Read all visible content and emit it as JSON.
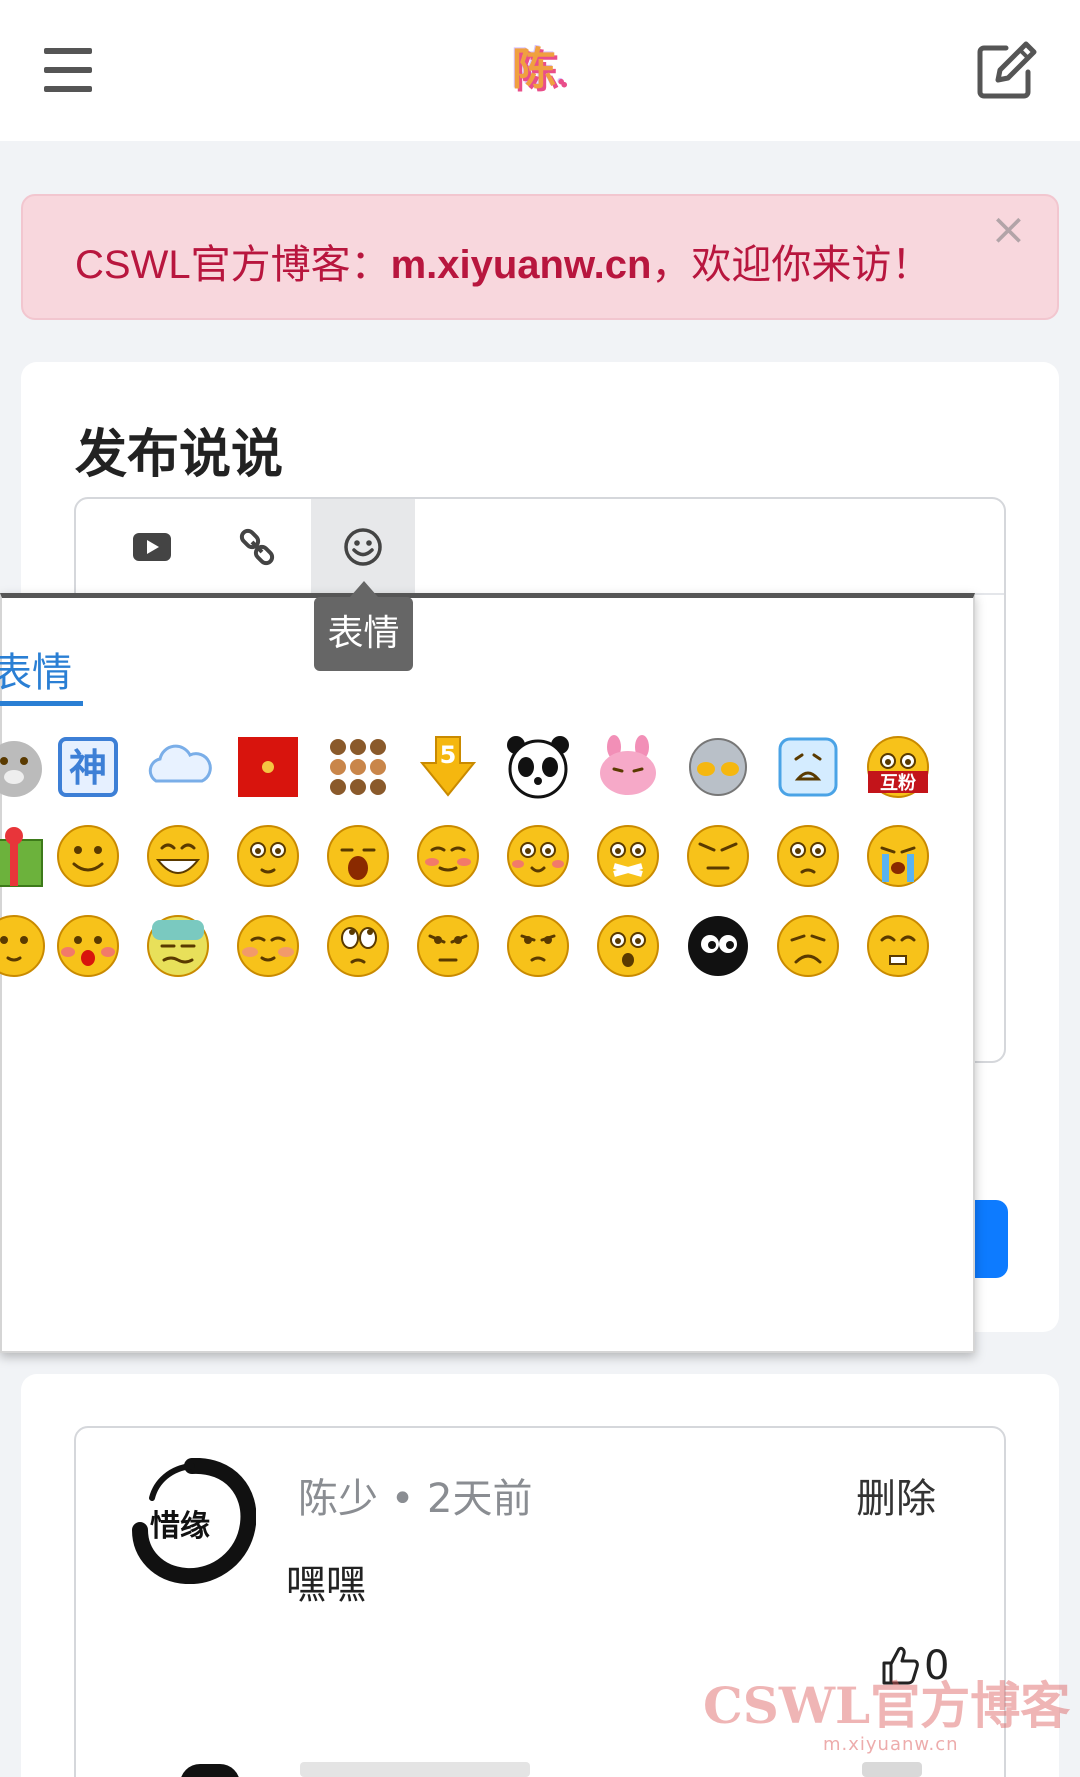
{
  "header": {
    "menu_icon": "hamburger-icon",
    "logo_text": "陈",
    "logo_dot": ".",
    "edit_icon": "edit-icon"
  },
  "alert": {
    "prefix": "CSWL官方博客：",
    "url": "m.xiyuanw.cn",
    "suffix": "，欢迎你来访！",
    "close": "×"
  },
  "composer": {
    "title": "发布说说",
    "toolbar": [
      {
        "icon": "video-icon"
      },
      {
        "icon": "link-icon"
      },
      {
        "icon": "emoji-icon",
        "active": true
      }
    ],
    "tooltip": "表情"
  },
  "emoji_popup": {
    "tab_label": "表情",
    "rows": [
      [
        "bear",
        "shen-sign",
        "cloud",
        "red-envelope",
        "crowd",
        "gold-arrow-5",
        "panda",
        "pink-rabbit",
        "ultraman",
        "blue-face",
        "hu-fen"
      ],
      [
        "gift",
        "smile",
        "grin",
        "big-eyes",
        "yawn",
        "shy",
        "cute",
        "cover-mouth",
        "grumpy",
        "teary",
        "cry"
      ],
      [
        "half-face",
        "blush-kiss",
        "sweat",
        "rosy",
        "roll-eyes",
        "angry",
        "disdain",
        "surprised",
        "black-ball",
        "upset",
        "cheeky"
      ]
    ]
  },
  "feed": {
    "items": [
      {
        "avatar_text": "惜缘",
        "author": "陈少",
        "dot": "•",
        "time": "2天前",
        "delete": "删除",
        "content": "嘿嘿",
        "likes": "0"
      }
    ]
  },
  "watermark": {
    "title": "CSWL官方博客",
    "url": "m.xiyuanw.cn"
  }
}
